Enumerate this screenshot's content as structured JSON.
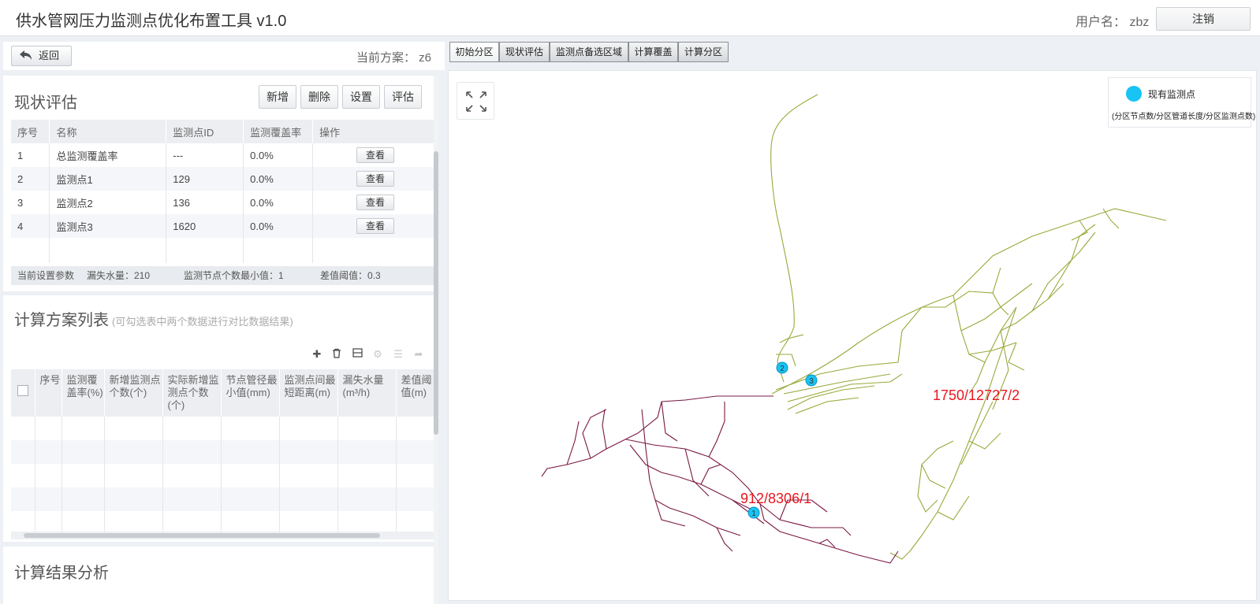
{
  "header": {
    "title": "供水管网压力监测点优化布置工具 v1.0",
    "user_label": "用户名： zbz",
    "logout": "注销"
  },
  "toolbar": {
    "back": "返回",
    "scheme_label": "当前方案： z6"
  },
  "tabs": [
    "初始分区",
    "现状评估",
    "监测点备选区域",
    "计算覆盖",
    "计算分区"
  ],
  "status": {
    "title": "现状评估",
    "buttons": {
      "add": "新增",
      "delete": "删除",
      "settings": "设置",
      "evaluate": "评估"
    },
    "columns": [
      "序号",
      "名称",
      "监测点ID",
      "监测覆盖率",
      "操作"
    ],
    "rows": [
      {
        "no": "1",
        "name": "总监测覆盖率",
        "id": "---",
        "rate": "0.0%",
        "op": "查看"
      },
      {
        "no": "2",
        "name": "监测点1",
        "id": "129",
        "rate": "0.0%",
        "op": "查看"
      },
      {
        "no": "3",
        "name": "监测点2",
        "id": "136",
        "rate": "0.0%",
        "op": "查看"
      },
      {
        "no": "4",
        "name": "监测点3",
        "id": "1620",
        "rate": "0.0%",
        "op": "查看"
      }
    ],
    "params": {
      "label": "当前设置参数",
      "leak": "漏失水量：210",
      "min_nodes": "监测节点个数最小值：1",
      "threshold": "差值阈值：0.3"
    }
  },
  "schemes": {
    "title": "计算方案列表",
    "hint": "(可勾选表中两个数据进行对比数据结果)",
    "columns": [
      "序号",
      "监测覆盖率(%)",
      "新增监测点个数(个)",
      "实际新增监测点个数(个)",
      "节点管径最小值(mm)",
      "监测点间最短距离(m)",
      "漏失水量(m³/h)",
      "差值阈值(m)"
    ]
  },
  "result": {
    "title": "计算结果分析"
  },
  "map": {
    "legend_title": "现有监测点",
    "legend_sub": "(分区节点数/分区管道长度/分区监测点数)",
    "zones": [
      {
        "label": "1750/12727/2",
        "color": "#9aa83a"
      },
      {
        "label": "912/8306/1",
        "color": "#7a1844"
      }
    ],
    "markers": [
      "1",
      "2",
      "3"
    ],
    "marker_color": "#17c4f4"
  }
}
